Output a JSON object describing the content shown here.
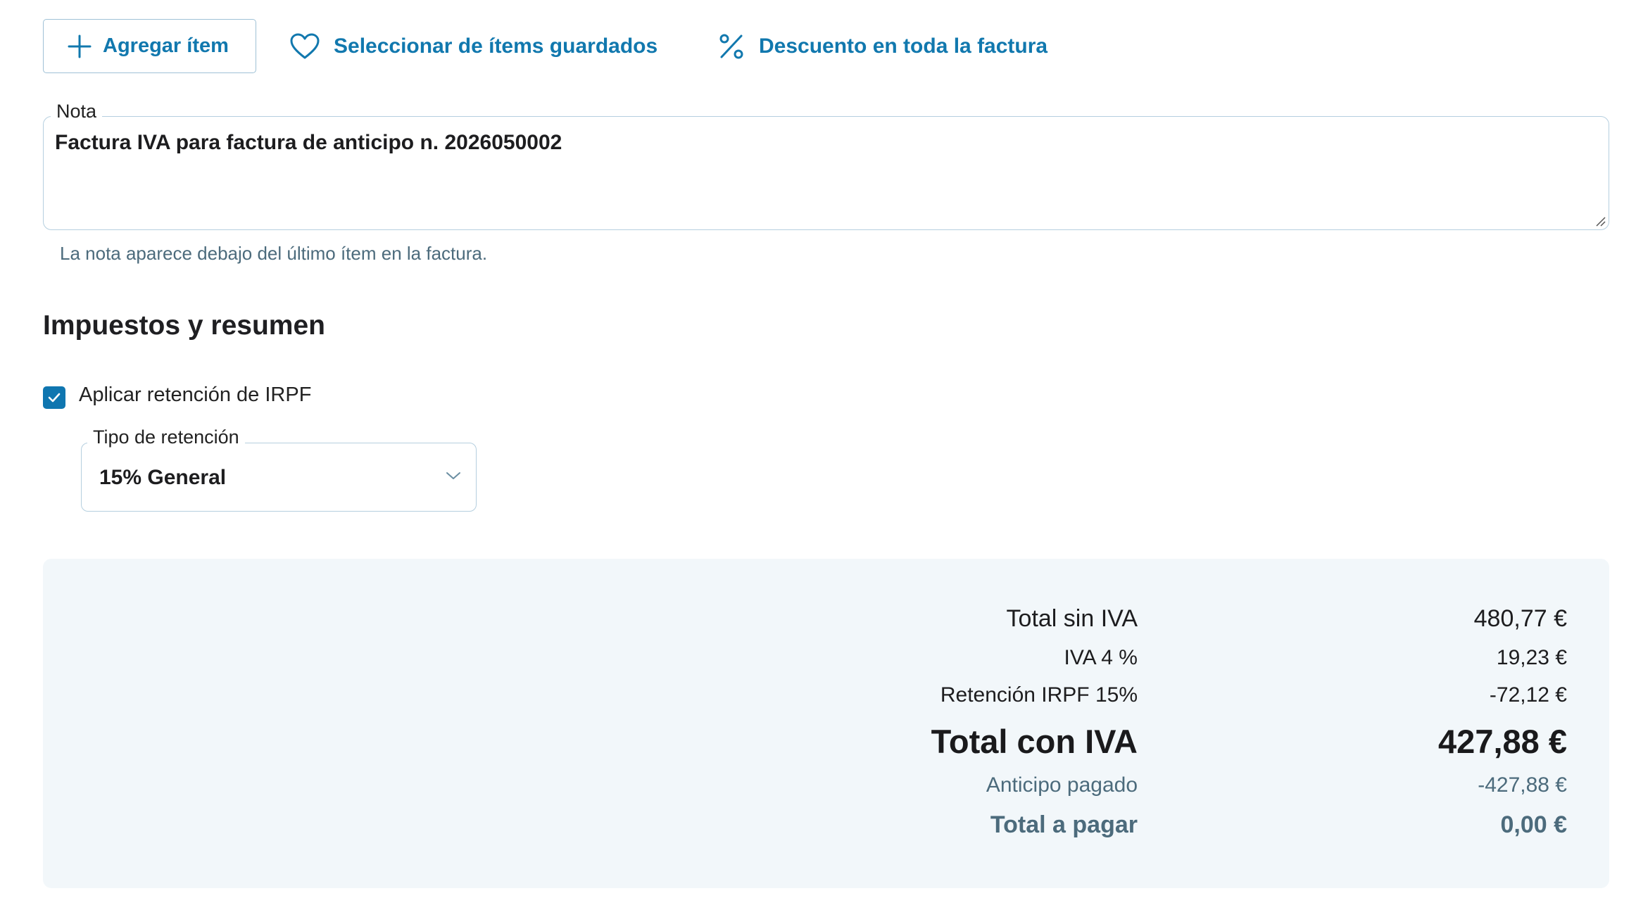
{
  "toolbar": {
    "add_item_label": "Agregar ítem",
    "saved_items_label": "Seleccionar de ítems guardados",
    "discount_label": "Descuento en toda la factura"
  },
  "note": {
    "label": "Nota",
    "value": "Factura IVA para factura de anticipo n. 2026050002",
    "help": "La nota aparece debajo del último ítem en la factura."
  },
  "taxes": {
    "section_title": "Impuestos y resumen",
    "irpf_checkbox_label": "Aplicar retención de IRPF",
    "irpf_checked": true,
    "retention_type_label": "Tipo de retención",
    "retention_type_value": "15% General"
  },
  "summary": {
    "subtotal_label": "Total sin IVA",
    "subtotal_value": "480,77 €",
    "vat_label": "IVA 4 %",
    "vat_value": "19,23 €",
    "irpf_label": "Retención IRPF 15%",
    "irpf_value": "-72,12 €",
    "total_label": "Total con IVA",
    "total_value": "427,88 €",
    "advance_label": "Anticipo pagado",
    "advance_value": "-427,88 €",
    "due_label": "Total a pagar",
    "due_value": "0,00 €"
  },
  "colors": {
    "accent": "#1178ae",
    "muted": "#4c6b7c",
    "panel_bg": "#f2f7fa",
    "border": "#b5cfdf"
  },
  "icons": {
    "add": "plus-icon",
    "saved": "heart-icon",
    "discount": "percent-icon",
    "check": "check-icon",
    "select": "chevron-down-icon"
  }
}
